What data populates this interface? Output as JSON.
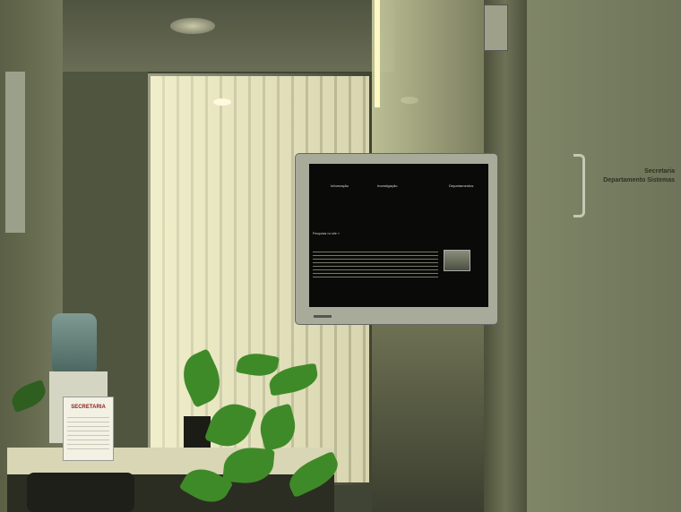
{
  "scene": {
    "description_tag": "photo",
    "monitor": {
      "nav_items": [
        "Informação",
        "Investigação",
        "Departamentos"
      ],
      "list_lines": [
        "Pesquisar no site »"
      ],
      "headline": "",
      "status": ""
    },
    "door_sign": {
      "line1": "Secretaria",
      "line2": "Departamento Sistemas"
    },
    "desk_sign": {
      "title": "SECRETARIA"
    },
    "colors": {
      "wall": "#6e7459",
      "blinds": "#e2dfb9",
      "screen": "#0a0b08",
      "plant": "#3f8a28"
    }
  }
}
